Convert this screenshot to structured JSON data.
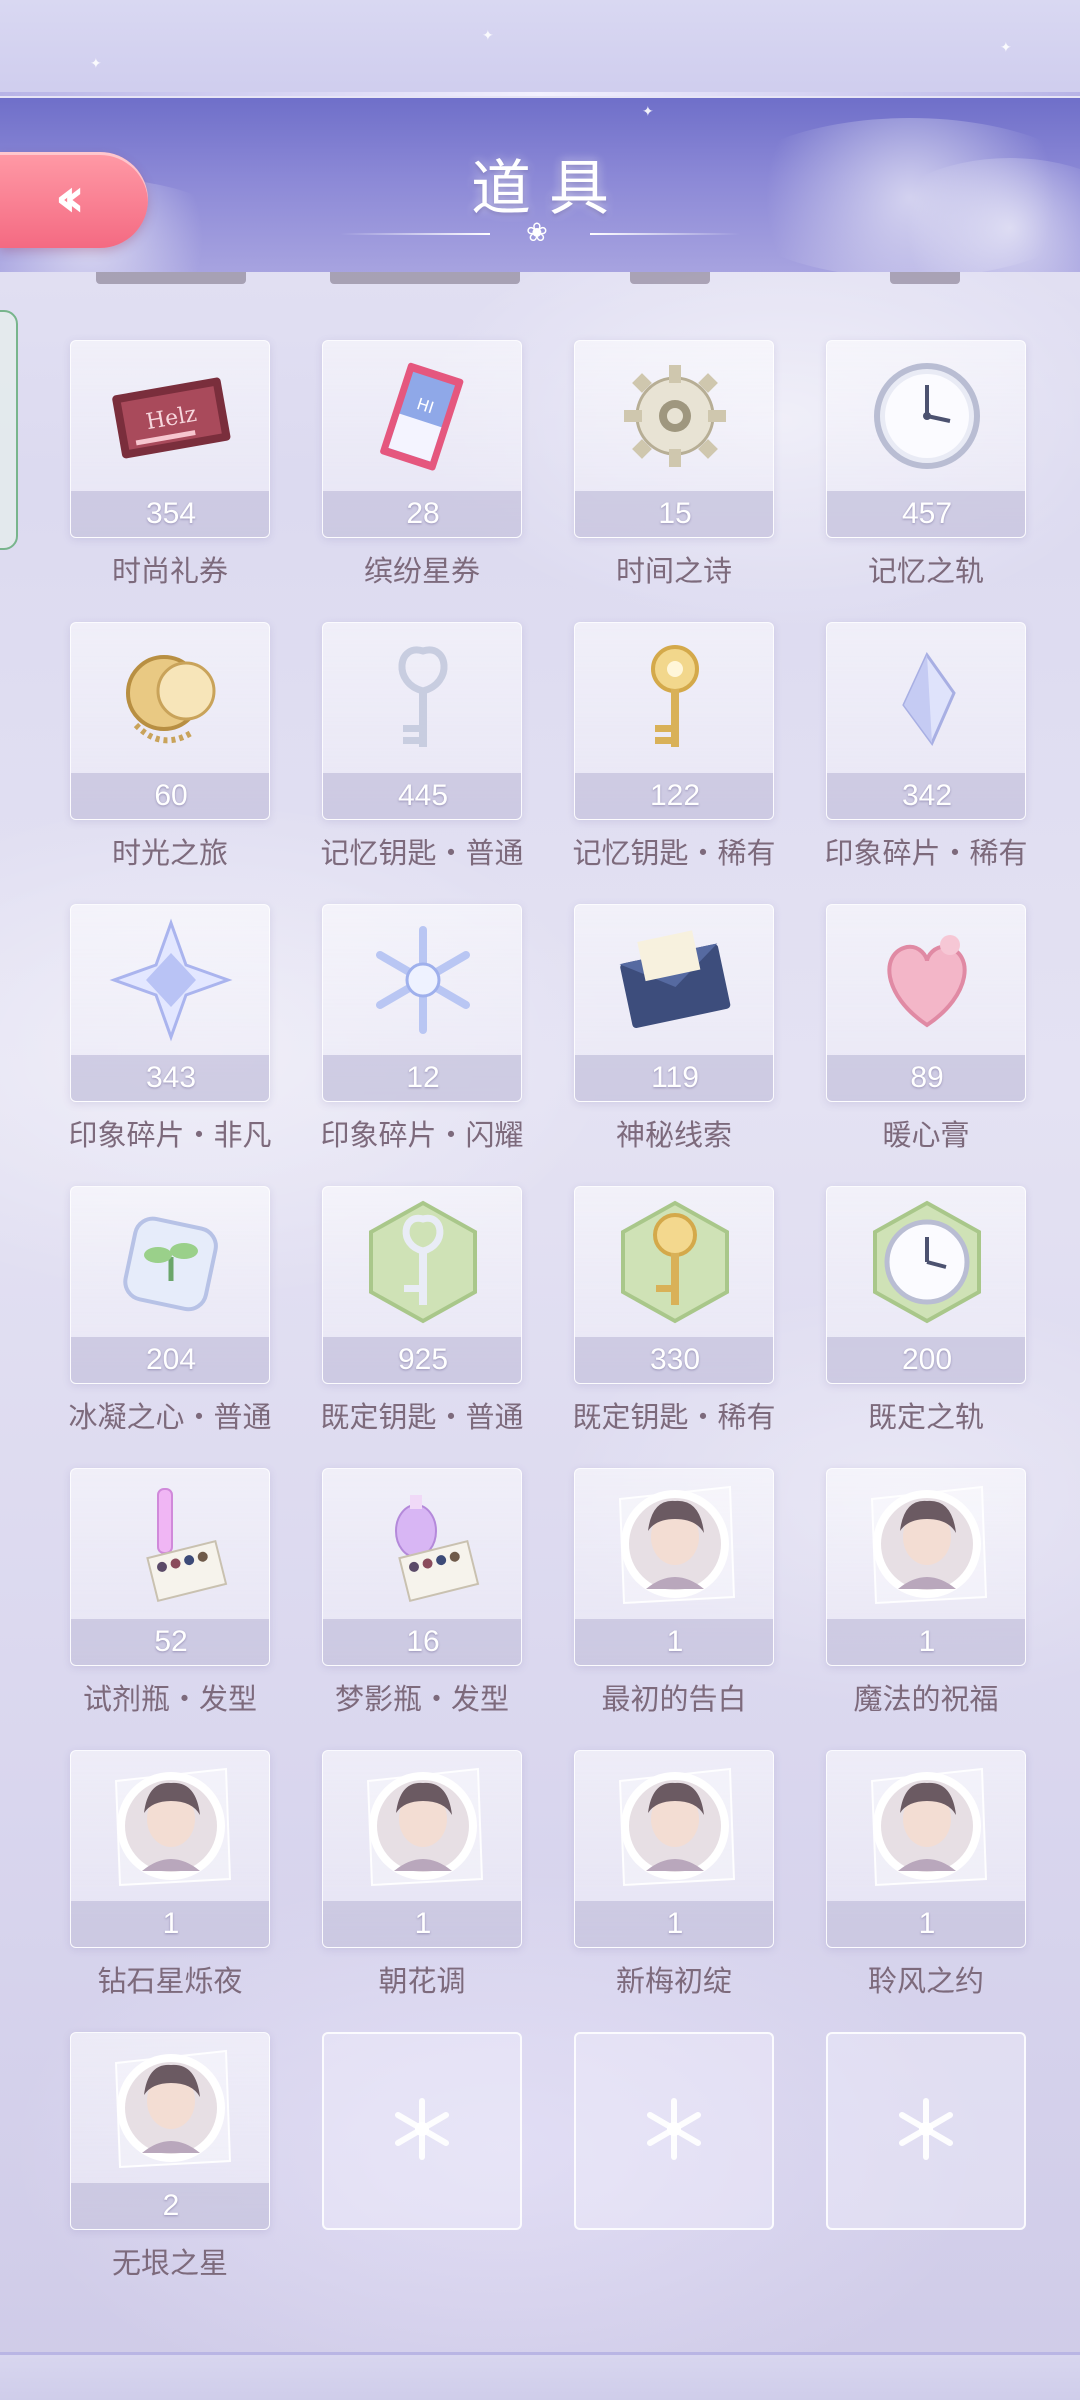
{
  "header": {
    "title": "道具",
    "back_icon": "double-chevron-left-icon"
  },
  "colors": {
    "back_button": "#f46a82",
    "header_band": "#7f7ccf",
    "label_text": "#7d6a7c",
    "count_bar": "#b6b2d4"
  },
  "items": [
    {
      "name": "时尚礼券",
      "count": "354",
      "icon": "fashion-voucher-card-icon"
    },
    {
      "name": "缤纷星券",
      "count": "28",
      "icon": "star-ticket-icon"
    },
    {
      "name": "时间之诗",
      "count": "15",
      "icon": "gear-icon"
    },
    {
      "name": "记忆之轨",
      "count": "457",
      "icon": "clock-icon"
    },
    {
      "name": "时光之旅",
      "count": "60",
      "icon": "golden-clockwork-icon"
    },
    {
      "name": "记忆钥匙・普通",
      "count": "445",
      "icon": "silver-key-icon"
    },
    {
      "name": "记忆钥匙・稀有",
      "count": "122",
      "icon": "golden-key-icon"
    },
    {
      "name": "印象碎片・稀有",
      "count": "342",
      "icon": "crystal-shard-icon"
    },
    {
      "name": "印象碎片・非凡",
      "count": "343",
      "icon": "star-crystal-icon"
    },
    {
      "name": "印象碎片・闪耀",
      "count": "12",
      "icon": "snowflake-crystal-icon"
    },
    {
      "name": "神秘线索",
      "count": "119",
      "icon": "envelope-icon"
    },
    {
      "name": "暖心膏",
      "count": "89",
      "icon": "heart-box-icon"
    },
    {
      "name": "冰凝之心・普通",
      "count": "204",
      "icon": "ice-cube-sprout-icon"
    },
    {
      "name": "既定钥匙・普通",
      "count": "925",
      "icon": "silver-key-hexagon-icon"
    },
    {
      "name": "既定钥匙・稀有",
      "count": "330",
      "icon": "golden-key-hexagon-icon"
    },
    {
      "name": "既定之轨",
      "count": "200",
      "icon": "clock-hexagon-icon"
    },
    {
      "name": "试剂瓶・发型",
      "count": "52",
      "icon": "reagent-bottle-icon"
    },
    {
      "name": "梦影瓶・发型",
      "count": "16",
      "icon": "dream-bottle-icon"
    },
    {
      "name": "最初的告白",
      "count": "1",
      "icon": "portrait-medallion-icon"
    },
    {
      "name": "魔法的祝福",
      "count": "1",
      "icon": "portrait-medallion-icon"
    },
    {
      "name": "钻石星烁夜",
      "count": "1",
      "icon": "portrait-medallion-icon"
    },
    {
      "name": "朝花调",
      "count": "1",
      "icon": "portrait-medallion-icon"
    },
    {
      "name": "新梅初绽",
      "count": "1",
      "icon": "portrait-medallion-icon"
    },
    {
      "name": "聆风之约",
      "count": "1",
      "icon": "portrait-medallion-icon"
    },
    {
      "name": "无垠之星",
      "count": "2",
      "icon": "portrait-medallion-icon"
    }
  ],
  "empty_slot_icon": "snowflake-placeholder-icon"
}
